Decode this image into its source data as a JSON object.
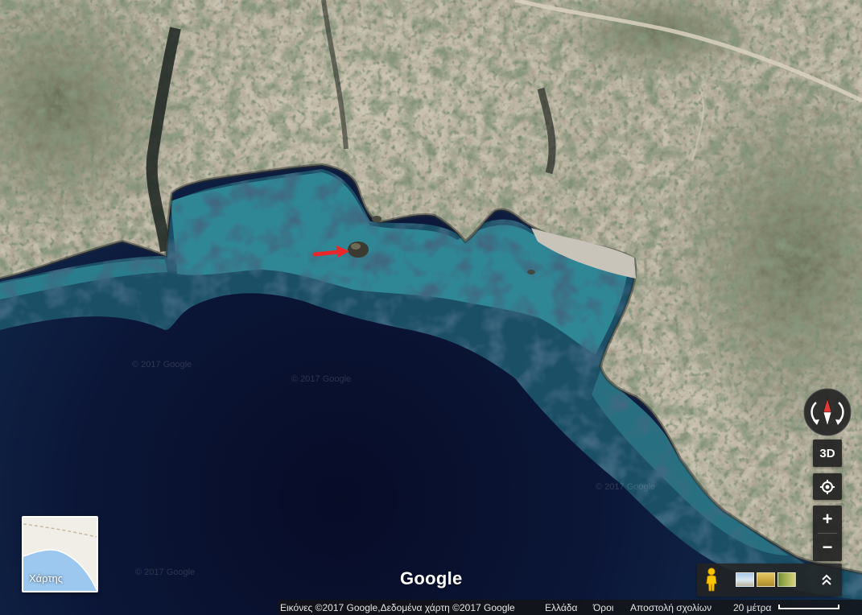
{
  "map": {
    "watermarks": [
      "© 2017 Google",
      "© 2017 Google",
      "© 2017 Google",
      "© 2017 Google"
    ],
    "marker": {
      "icon": "red-arrow-icon",
      "color": "#e8262b"
    }
  },
  "logo": {
    "text": "Google"
  },
  "map_type_toggle": {
    "label": "Χάρτης"
  },
  "controls": {
    "compass_icon": "compass-icon",
    "tilt_label": "3D",
    "my_location_icon": "my-location-icon",
    "zoom_in_label": "+",
    "zoom_out_label": "−"
  },
  "imagery_strip": {
    "pegman_icon": "pegman-icon",
    "expand_icon": "double-chevron-up-icon"
  },
  "footer": {
    "attribution": "Εικόνες ©2017 Google,Δεδομένα χάρτη ©2017 Google",
    "region": "Ελλάδα",
    "terms": "Όροι",
    "feedback": "Αποστολή σχολίων",
    "scale_label": "20 μέτρα"
  },
  "colors": {
    "control_background": "#222222",
    "pegman": "#f9c400",
    "compass_needle": "#e53935"
  }
}
